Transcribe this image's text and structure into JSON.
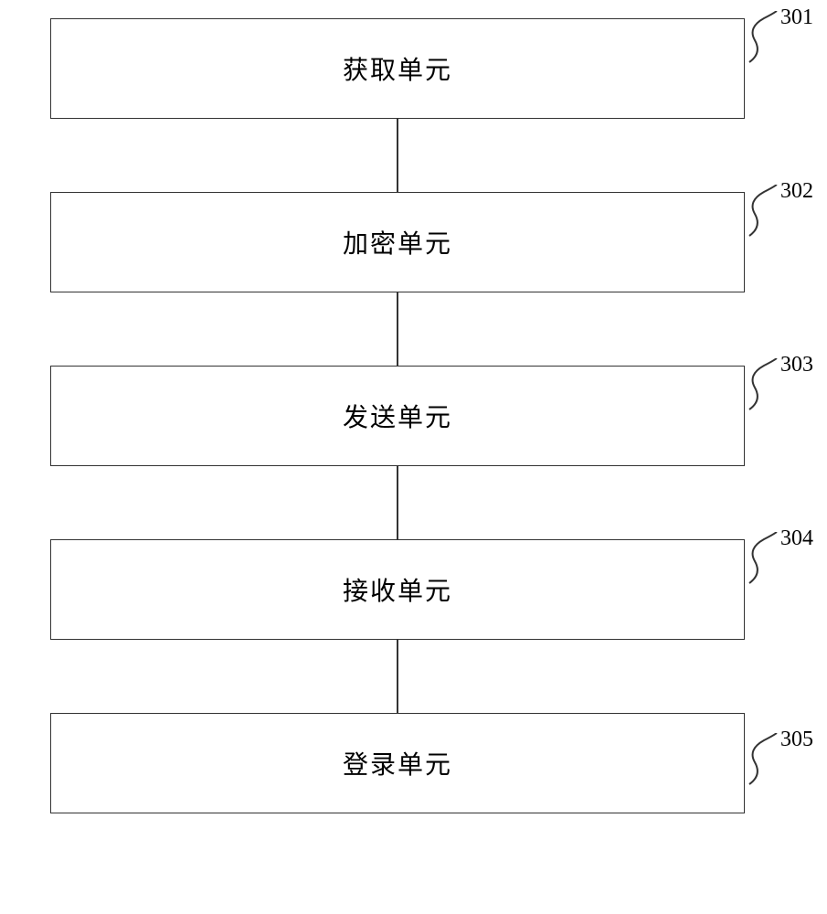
{
  "blocks": [
    {
      "label": "获取单元",
      "ref": "301"
    },
    {
      "label": "加密单元",
      "ref": "302"
    },
    {
      "label": "发送单元",
      "ref": "303"
    },
    {
      "label": "接收单元",
      "ref": "304"
    },
    {
      "label": "登录单元",
      "ref": "305"
    }
  ]
}
